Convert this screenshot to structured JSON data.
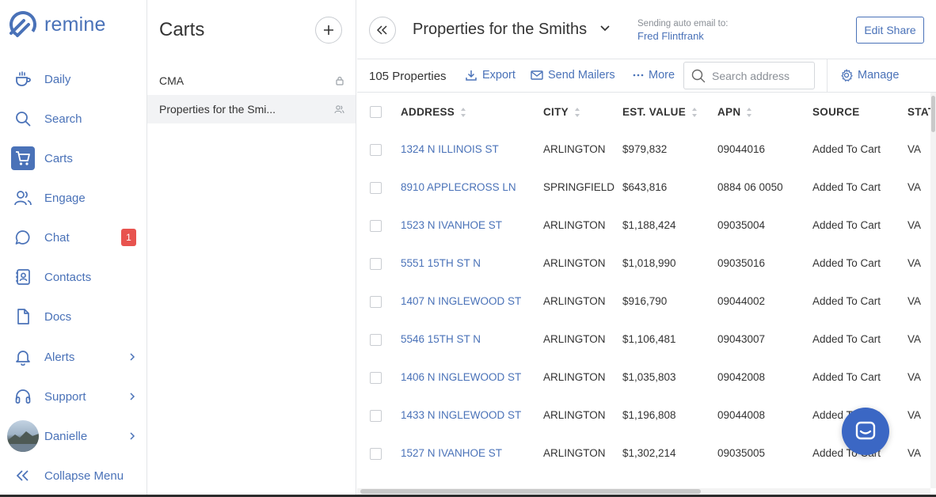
{
  "brand": {
    "name": "remine",
    "accent": "#4a72b8"
  },
  "nav": {
    "items": [
      {
        "label": "Daily",
        "icon": "coffee-cup-icon"
      },
      {
        "label": "Search",
        "icon": "search-icon"
      },
      {
        "label": "Carts",
        "icon": "cart-icon",
        "active": true
      },
      {
        "label": "Engage",
        "icon": "people-icon"
      },
      {
        "label": "Chat",
        "icon": "chat-bubble-icon",
        "badge": "1"
      },
      {
        "label": "Contacts",
        "icon": "contact-book-icon"
      },
      {
        "label": "Docs",
        "icon": "document-icon"
      },
      {
        "label": "Alerts",
        "icon": "bell-icon"
      },
      {
        "label": "Support",
        "icon": "headset-icon"
      },
      {
        "label": "Danielle",
        "icon": "avatar"
      },
      {
        "label": "Collapse Menu",
        "icon": "double-chevron-left-icon"
      }
    ]
  },
  "carts": {
    "title": "Carts",
    "items": [
      {
        "label": "CMA",
        "icon": "lock-icon"
      },
      {
        "label": "Properties for the Smi...",
        "icon": "shared-users-icon",
        "selected": true
      }
    ]
  },
  "header": {
    "title": "Properties for the Smiths",
    "send_label": "Sending auto email to:",
    "send_name": "Fred Flintfrank",
    "edit_share": "Edit Share"
  },
  "toolbar": {
    "count": "105 Properties",
    "export": "Export",
    "send_mailers": "Send Mailers",
    "more": "More",
    "search_placeholder": "Search address",
    "manage": "Manage"
  },
  "table": {
    "columns": [
      "ADDRESS",
      "CITY",
      "EST. VALUE",
      "APN",
      "SOURCE",
      "STAT"
    ],
    "rows": [
      {
        "address": "1324 N ILLINOIS ST",
        "city": "ARLINGTON",
        "value": "$979,832",
        "apn": "09044016",
        "source": "Added To Cart",
        "state": "VA"
      },
      {
        "address": "8910 APPLECROSS LN",
        "city": "SPRINGFIELD",
        "value": "$643,816",
        "apn": "0884 06 0050",
        "source": "Added To Cart",
        "state": "VA"
      },
      {
        "address": "1523 N IVANHOE ST",
        "city": "ARLINGTON",
        "value": "$1,188,424",
        "apn": "09035004",
        "source": "Added To Cart",
        "state": "VA"
      },
      {
        "address": "5551 15TH ST N",
        "city": "ARLINGTON",
        "value": "$1,018,990",
        "apn": "09035016",
        "source": "Added To Cart",
        "state": "VA"
      },
      {
        "address": "1407 N INGLEWOOD ST",
        "city": "ARLINGTON",
        "value": "$916,790",
        "apn": "09044002",
        "source": "Added To Cart",
        "state": "VA"
      },
      {
        "address": "5546 15TH ST N",
        "city": "ARLINGTON",
        "value": "$1,106,481",
        "apn": "09043007",
        "source": "Added To Cart",
        "state": "VA"
      },
      {
        "address": "1406 N INGLEWOOD ST",
        "city": "ARLINGTON",
        "value": "$1,035,803",
        "apn": "09042008",
        "source": "Added To Cart",
        "state": "VA"
      },
      {
        "address": "1433 N INGLEWOOD ST",
        "city": "ARLINGTON",
        "value": "$1,196,808",
        "apn": "09044008",
        "source": "Added To Cart",
        "state": "VA"
      },
      {
        "address": "1527 N IVANHOE ST",
        "city": "ARLINGTON",
        "value": "$1,302,214",
        "apn": "09035005",
        "source": "Added To Cart",
        "state": "VA"
      }
    ]
  }
}
